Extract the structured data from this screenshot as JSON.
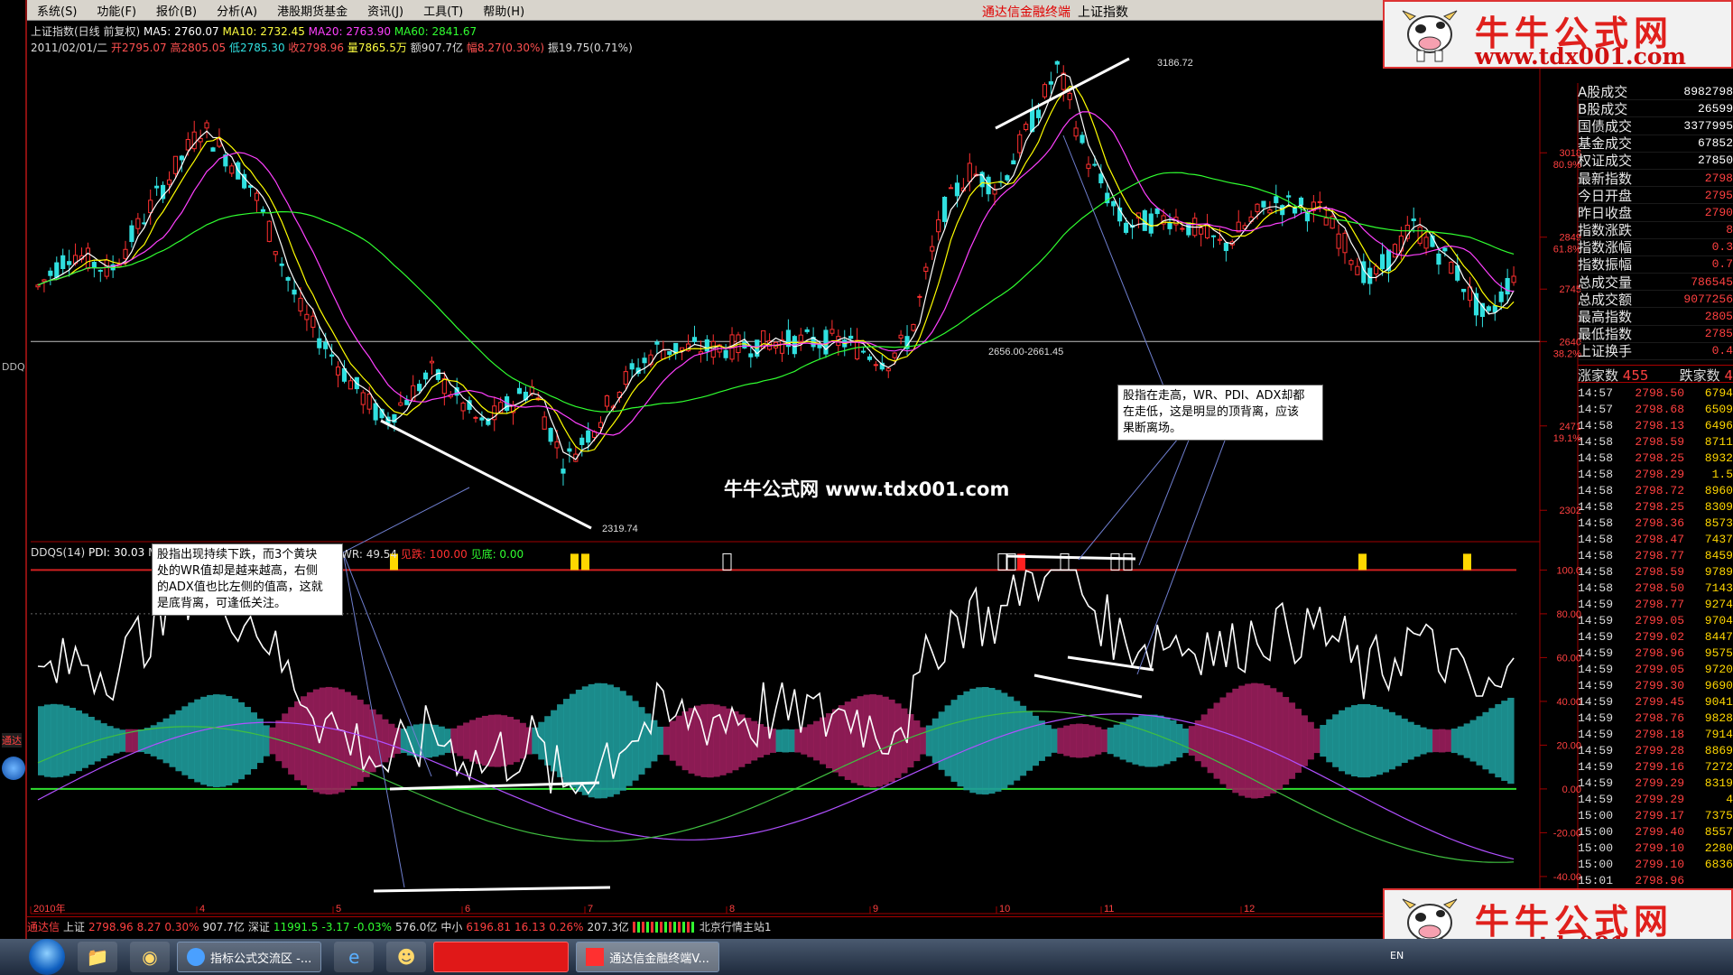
{
  "menu": [
    "系统(S)",
    "功能(F)",
    "报价(B)",
    "分析(A)",
    "港股期货基金",
    "资讯(J)",
    "工具(T)",
    "帮助(H)"
  ],
  "app_title": {
    "left": "通达信金融终端",
    "right": "上证指数"
  },
  "info_line1": {
    "name": "上证指数(日线 前复权)",
    "ma5": "MA5: 2760.07",
    "ma10": "MA10: 2732.45",
    "ma20": "MA20: 2763.90",
    "ma60": "MA60: 2841.67"
  },
  "info_line2": {
    "date": "2011/02/01/二",
    "open": "开2795.07",
    "high": "高2805.05",
    "low": "低2785.30",
    "close": "收2798.96",
    "vol": "量7865.5万",
    "amount": "额907.7亿",
    "change": "幅8.27(0.30%)",
    "amplitude": "振19.75(0.71%)"
  },
  "indicator_line": {
    "name": "DDQS(14)",
    "pdi": "PDI: 30.03",
    "m": "M",
    "wr": "WR: 49.54",
    "jiandie": "见跌: 100.00",
    "jiandi": "见底: 0.00"
  },
  "price_axis": [
    "3018",
    "2849",
    "2745",
    "2640",
    "2471",
    "2302"
  ],
  "pct_axis": [
    "80.9%",
    "61.8%",
    "38.2%",
    "19.1%"
  ],
  "ind_axis": [
    "100.0",
    "80.00",
    "60.00",
    "40.00",
    "20.00",
    "0.00",
    "-20.00",
    "-40.00"
  ],
  "date_axis": [
    "2010年",
    "4",
    "5",
    "6",
    "7",
    "8",
    "9",
    "10",
    "11",
    "12"
  ],
  "price_labels": {
    "high": "3186.72",
    "low": "2319.74",
    "range": "2656.00-2661.45"
  },
  "watermark": {
    "cn": "牛牛公式网",
    "url": "www.tdx001.com"
  },
  "center_watermark": "牛牛公式网 www.tdx001.com",
  "annotation_left": [
    "股指出现持续下跌，而3个黄块",
    "处的WR值却是越来越高，右侧",
    "的ADX值也比左侧的值高，这就",
    "是底背离，可逢低关注。"
  ],
  "annotation_right": [
    "股指在走高，WR、PDI、ADX却都",
    "在走低，这是明显的顶背离，应该",
    "果断离场。"
  ],
  "right_panel": [
    {
      "label": "A股成交",
      "value": "8982798"
    },
    {
      "label": "B股成交",
      "value": "26599"
    },
    {
      "label": "国债成交",
      "value": "3377995"
    },
    {
      "label": "基金成交",
      "value": "67852"
    },
    {
      "label": "权证成交",
      "value": "27850"
    },
    {
      "label": "最新指数",
      "value": "2798"
    },
    {
      "label": "今日开盘",
      "value": "2795"
    },
    {
      "label": "昨日收盘",
      "value": "2790"
    },
    {
      "label": "指数涨跌",
      "value": "8"
    },
    {
      "label": "指数涨幅",
      "value": "0.3"
    },
    {
      "label": "指数振幅",
      "value": "0.7"
    },
    {
      "label": "总成交量",
      "value": "786545"
    },
    {
      "label": "总成交额",
      "value": "9077256"
    },
    {
      "label": "最高指数",
      "value": "2805"
    },
    {
      "label": "最低指数",
      "value": "2785"
    },
    {
      "label": "上证换手",
      "value": "0.4"
    }
  ],
  "tick_header": {
    "rise_label": "涨家数",
    "rise": "455",
    "fall_label": "跌家数",
    "fall": "4"
  },
  "ticks": [
    {
      "t": "14:57",
      "p": "2798.50",
      "n": "6794"
    },
    {
      "t": "14:57",
      "p": "2798.68",
      "n": "6509"
    },
    {
      "t": "14:58",
      "p": "2798.13",
      "n": "6496"
    },
    {
      "t": "14:58",
      "p": "2798.59",
      "n": "8711"
    },
    {
      "t": "14:58",
      "p": "2798.25",
      "n": "8932"
    },
    {
      "t": "14:58",
      "p": "2798.29",
      "n": "1.5"
    },
    {
      "t": "14:58",
      "p": "2798.72",
      "n": "8960"
    },
    {
      "t": "14:58",
      "p": "2798.25",
      "n": "8309"
    },
    {
      "t": "14:58",
      "p": "2798.36",
      "n": "8573"
    },
    {
      "t": "14:58",
      "p": "2798.47",
      "n": "7437"
    },
    {
      "t": "14:58",
      "p": "2798.77",
      "n": "8459"
    },
    {
      "t": "14:58",
      "p": "2798.59",
      "n": "9789"
    },
    {
      "t": "14:58",
      "p": "2798.50",
      "n": "7143"
    },
    {
      "t": "14:59",
      "p": "2798.77",
      "n": "9274"
    },
    {
      "t": "14:59",
      "p": "2799.05",
      "n": "9704"
    },
    {
      "t": "14:59",
      "p": "2799.02",
      "n": "8447"
    },
    {
      "t": "14:59",
      "p": "2798.96",
      "n": "9575"
    },
    {
      "t": "14:59",
      "p": "2799.05",
      "n": "9720"
    },
    {
      "t": "14:59",
      "p": "2799.30",
      "n": "9690"
    },
    {
      "t": "14:59",
      "p": "2799.45",
      "n": "9041"
    },
    {
      "t": "14:59",
      "p": "2798.76",
      "n": "9828"
    },
    {
      "t": "14:59",
      "p": "2798.18",
      "n": "7914"
    },
    {
      "t": "14:59",
      "p": "2799.28",
      "n": "8869"
    },
    {
      "t": "14:59",
      "p": "2799.16",
      "n": "7272"
    },
    {
      "t": "14:59",
      "p": "2799.29",
      "n": "8319"
    },
    {
      "t": "14:59",
      "p": "2799.29",
      "n": "4"
    },
    {
      "t": "15:00",
      "p": "2799.17",
      "n": "7375"
    },
    {
      "t": "15:00",
      "p": "2799.40",
      "n": "8557"
    },
    {
      "t": "15:00",
      "p": "2799.10",
      "n": "2280"
    },
    {
      "t": "15:00",
      "p": "2799.10",
      "n": "6836"
    },
    {
      "t": "15:01",
      "p": "2798.96",
      "n": ""
    }
  ],
  "status_bar": {
    "app": "通达信",
    "sh_name": "上证",
    "sh_price": "2798.96",
    "sh_chg": "8.27",
    "sh_pct": "0.30%",
    "sh_amt": "907.7亿",
    "sz_name": "深证",
    "sz_price": "11991.5",
    "sz_chg": "-3.17",
    "sz_pct": "-0.03%",
    "sz_amt": "576.0亿",
    "zx_name": "中小",
    "zx_price": "6196.81",
    "zx_chg": "16.13",
    "zx_pct": "0.26%",
    "zx_amt": "207.3亿",
    "server": "北京行情主站1"
  },
  "left_strip": {
    "ddq": "DDQ",
    "tdx": "通达"
  },
  "taskbar": {
    "task1": "指标公式交流区 -...",
    "task3": "通达信金融终端V...",
    "tray": "EN"
  },
  "colors": {
    "up": "#ff3030",
    "down": "#30e0e0",
    "ma5": "#ffffff",
    "ma10": "#ffff00",
    "ma20": "#ff40ff",
    "ma60": "#30ff30",
    "wr": "#ffffff",
    "pdi_fill_teal": "#1e9a9a",
    "pdi_fill_maroon": "#9a1e5c",
    "adx": "#b050ff"
  }
}
